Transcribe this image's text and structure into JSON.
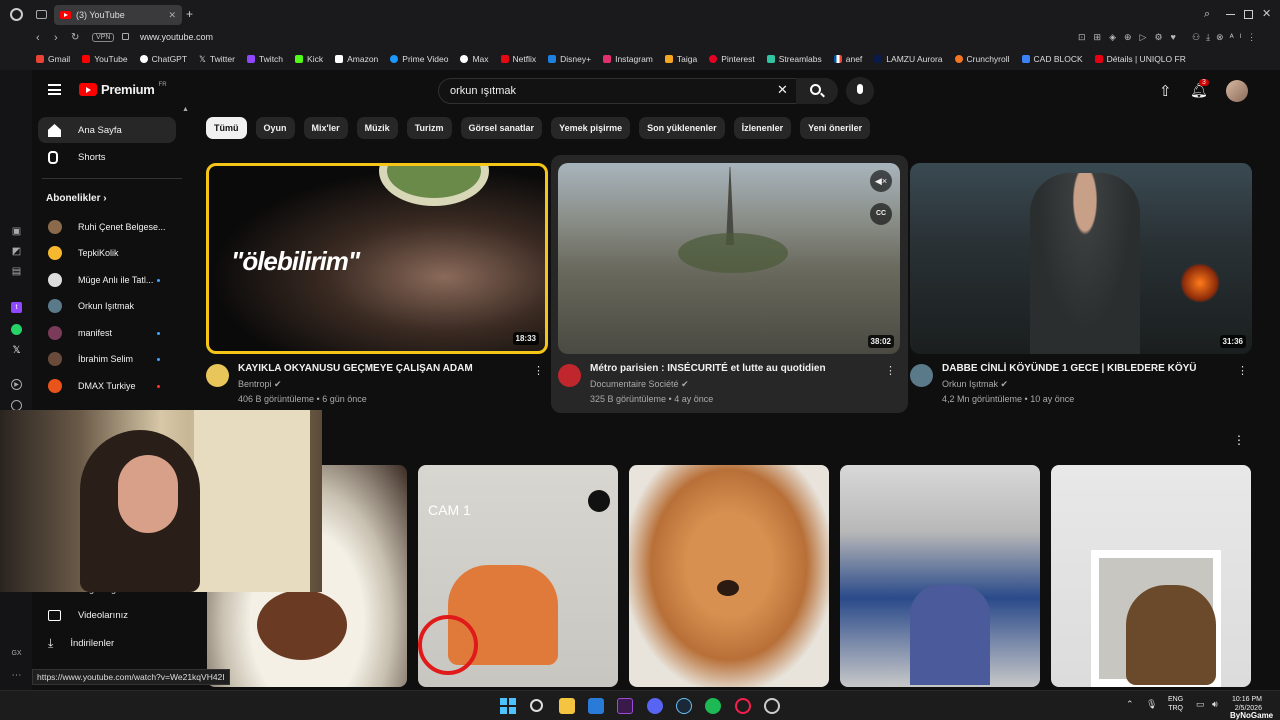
{
  "browser": {
    "tab_title": "(3) YouTube",
    "vpn_label": "VPN",
    "url": "www.youtube.com",
    "bookmarks": [
      "Gmail",
      "YouTube",
      "ChatGPT",
      "Twitter",
      "Twitch",
      "Kick",
      "Amazon",
      "Prime Video",
      "Max",
      "Netflix",
      "Disney+",
      "Instagram",
      "Taiga",
      "Pinterest",
      "Streamlabs",
      "anef",
      "LAMZU Aurora",
      "Crunchyroll",
      "CAD BLOCK",
      "Détails | UNIQLO FR"
    ],
    "bookmark_colors": [
      "#ea4335",
      "#ff0000",
      "#ffffff",
      "#ffffff",
      "#9146ff",
      "#53fc18",
      "#ffffff",
      "#1a98ff",
      "#ffffff",
      "#e50914",
      "#1f80e0",
      "#e1306c",
      "#f5a623",
      "#e60023",
      "#31c3a2",
      "#0055a4",
      "#0a1a4a",
      "#f47521",
      "#3b82f6",
      "#e60012"
    ],
    "status_url": "https://www.youtube.com/watch?v=We21kqVH42I"
  },
  "youtube": {
    "logo_text": "Premium",
    "logo_region": "FR",
    "search_query": "orkun ışıtmak",
    "notification_count": "3",
    "sidebar": {
      "home": "Ana Sayfa",
      "shorts": "Shorts",
      "subscriptions_header": "Abonelikler",
      "subscriptions": [
        {
          "name": "Ruhi Çenet Belgese...",
          "color": "#8a6a4a",
          "new": false
        },
        {
          "name": "TepkiKolik",
          "color": "#f5b82e",
          "new": false
        },
        {
          "name": "Müge Anlı ile Tatl...",
          "color": "#dddddd",
          "new": true
        },
        {
          "name": "Orkun Işıtmak",
          "color": "#5a7a8a",
          "new": false
        },
        {
          "name": "manifest",
          "color": "#7a3a5a",
          "new": true
        },
        {
          "name": "İbrahim Selim",
          "color": "#6a4a3a",
          "new": true
        },
        {
          "name": "DMAX Turkiye",
          "color": "#e8541a",
          "new": true
        }
      ],
      "liked_partial": "Beğendiğim videolar",
      "your_videos": "Videolarınız",
      "downloads": "İndirilenler"
    },
    "chips": [
      "Tümü",
      "Oyun",
      "Mix'ler",
      "Müzik",
      "Turizm",
      "Görsel sanatlar",
      "Yemek pişirme",
      "Son yüklenenler",
      "İzlenenler",
      "Yeni öneriler"
    ],
    "videos": [
      {
        "title": "KAYIKLA OKYANUSU GEÇMEYE ÇALIŞAN ADAM",
        "channel": "Bentropi",
        "meta": "406 B görüntüleme • 6 gün önce",
        "duration": "18:33",
        "overlay_text": "\"ölebilirim\"",
        "avatar_color": "#e8c65a"
      },
      {
        "title": "Métro parisien : INSÉCURITÉ et lutte au quotidien",
        "channel": "Documentaire Société",
        "meta": "325 B görüntüleme • 4 ay önce",
        "duration": "38:02",
        "avatar_color": "#c0272d"
      },
      {
        "title": "DABBE CİNLİ KÖYÜNDE 1 GECE | KIBLEDERE KÖYÜ",
        "channel": "Orkun Işıtmak",
        "meta": "4,2 Mn görüntüleme • 10 ay önce",
        "duration": "31:36",
        "avatar_color": "#5a7a8a"
      }
    ],
    "shorts_thumb_label": "CAM 1"
  },
  "taskbar": {
    "lang_top": "ENG",
    "lang_bottom": "TRQ",
    "time": "10:16 PM",
    "date": "2/5/2026",
    "watermark": "ByNoGame"
  }
}
